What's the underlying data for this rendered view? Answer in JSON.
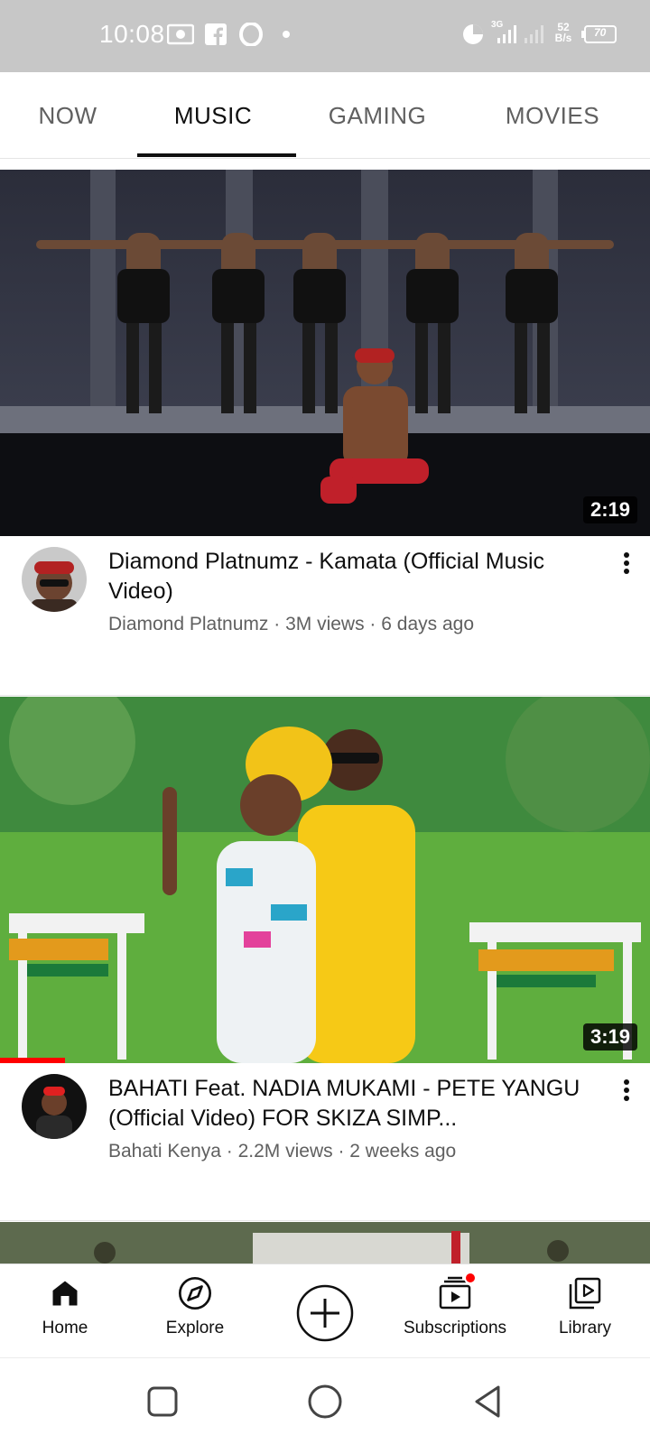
{
  "status_bar": {
    "time": "10:08",
    "network_type": "3G",
    "speed_value": "52",
    "speed_unit": "B/s",
    "battery": "70"
  },
  "tabs": [
    {
      "label": "NOW",
      "active": false
    },
    {
      "label": "MUSIC",
      "active": true
    },
    {
      "label": "GAMING",
      "active": false
    },
    {
      "label": "MOVIES",
      "active": false
    }
  ],
  "videos": [
    {
      "title": "Diamond Platnumz - Kamata (Official Music Video)",
      "channel": "Diamond Platnumz",
      "views": "3M views",
      "age": "6 days ago",
      "meta": "Diamond Platnumz · 3M views · 6 days ago",
      "duration": "2:19",
      "watched_fraction": 0
    },
    {
      "title": "BAHATI Feat. NADIA MUKAMI - PETE YANGU (Official Video) FOR SKIZA SIMP...",
      "channel": "Bahati Kenya",
      "views": "2.2M views",
      "age": "2 weeks ago",
      "meta": "Bahati Kenya · 2.2M views · 2 weeks ago",
      "duration": "3:19",
      "watched_fraction": 0.1
    }
  ],
  "bottom_nav": [
    {
      "label": "Home",
      "icon": "home-icon",
      "active": true
    },
    {
      "label": "Explore",
      "icon": "compass-icon",
      "active": false
    },
    {
      "label": "",
      "icon": "create-plus-icon",
      "active": false
    },
    {
      "label": "Subscriptions",
      "icon": "subscriptions-icon",
      "active": false,
      "badge": true
    },
    {
      "label": "Library",
      "icon": "library-icon",
      "active": false
    }
  ],
  "colors": {
    "accent_red": "#ff0000",
    "status_bar_bg": "#c7c7c7",
    "text_primary": "#0f0f0f",
    "text_secondary": "#606060"
  }
}
